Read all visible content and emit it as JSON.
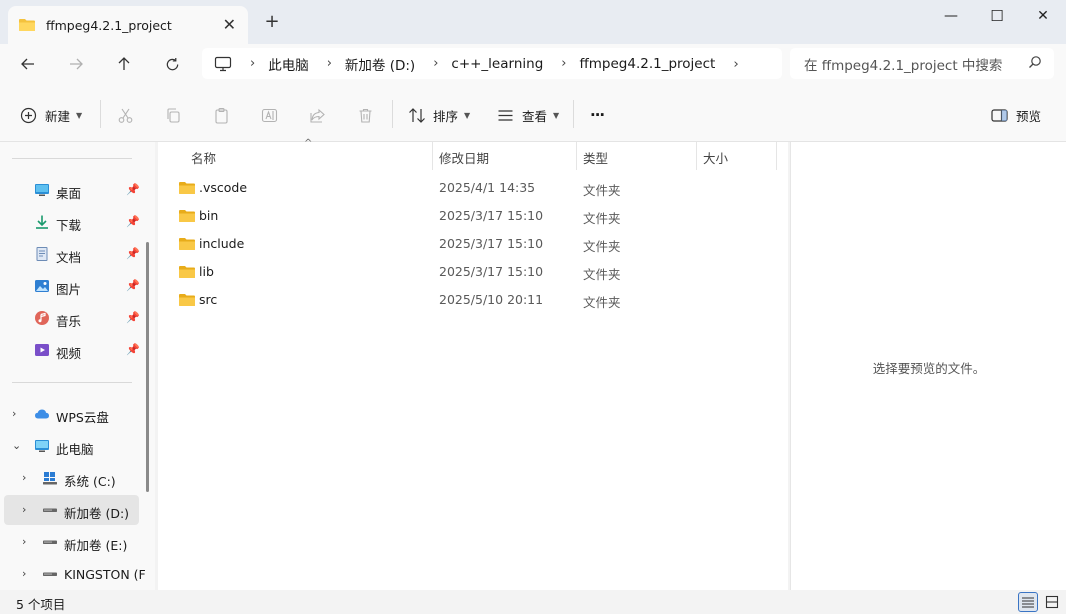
{
  "tab": {
    "title": "ffmpeg4.2.1_project",
    "close_label": "✕",
    "new_tab_label": "+"
  },
  "window": {
    "minimize": "—",
    "maximize": "☐",
    "close": "✕"
  },
  "address": {
    "crumbs": [
      "此电脑",
      "新加卷 (D:)",
      "c++_learning",
      "ffmpeg4.2.1_project"
    ],
    "separator": "›"
  },
  "search": {
    "placeholder": "在 ffmpeg4.2.1_project 中搜索"
  },
  "toolbar": {
    "new_label": "新建",
    "sort_label": "排序",
    "view_label": "查看",
    "more_label": "···",
    "preview_label": "预览"
  },
  "sidebar": {
    "quick_access": [
      {
        "label": "桌面",
        "icon": "desktop-icon"
      },
      {
        "label": "下载",
        "icon": "download-icon"
      },
      {
        "label": "文档",
        "icon": "document-icon"
      },
      {
        "label": "图片",
        "icon": "picture-icon"
      },
      {
        "label": "音乐",
        "icon": "music-icon"
      },
      {
        "label": "视频",
        "icon": "video-icon"
      }
    ],
    "cloud": {
      "label": "WPS云盘"
    },
    "this_pc": {
      "label": "此电脑"
    },
    "drives": [
      {
        "label": "系统 (C:)"
      },
      {
        "label": "新加卷 (D:)"
      },
      {
        "label": "新加卷 (E:)"
      },
      {
        "label": "KINGSTON (F"
      }
    ]
  },
  "columns": {
    "name": "名称",
    "modified": "修改日期",
    "type": "类型",
    "size": "大小"
  },
  "files": [
    {
      "name": ".vscode",
      "modified": "2025/4/1 14:35",
      "type": "文件夹"
    },
    {
      "name": "bin",
      "modified": "2025/3/17 15:10",
      "type": "文件夹"
    },
    {
      "name": "include",
      "modified": "2025/3/17 15:10",
      "type": "文件夹"
    },
    {
      "name": "lib",
      "modified": "2025/3/17 15:10",
      "type": "文件夹"
    },
    {
      "name": "src",
      "modified": "2025/5/10 20:11",
      "type": "文件夹"
    }
  ],
  "preview": {
    "empty_text": "选择要预览的文件。"
  },
  "status": {
    "item_count": "5 个项目"
  },
  "colors": {
    "folder": "#f4c23d",
    "accent": "#3a74c4",
    "tabbar": "#e8ecf2"
  }
}
